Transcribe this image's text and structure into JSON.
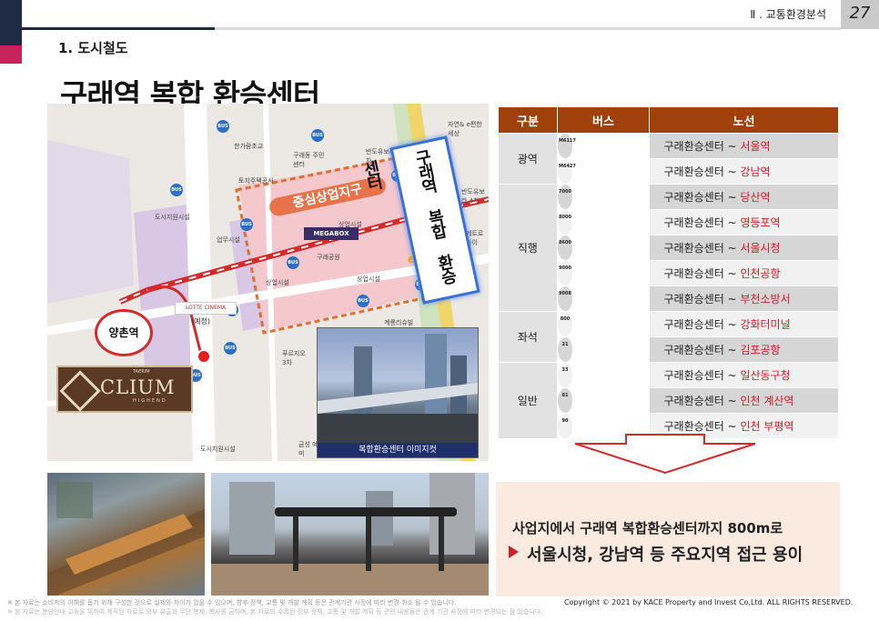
{
  "header": {
    "page_number": "27",
    "section": "Ⅱ . 교통환경분석"
  },
  "subtitle": "1. 도시철도",
  "title": "구래역 복합 환승센터",
  "map": {
    "zone_label": "중심상업지구",
    "center_banner": "구래역 복합 환승센터",
    "station": "양촌역",
    "megabox": "MEGABOX",
    "emart": "emart",
    "lotte": "LOTTE CINEMA",
    "lotte_note": "(예정)",
    "logo": {
      "brand": "CLIUM",
      "top": "TAERIM",
      "bottom": "HIGHEND"
    },
    "inset_caption": "복합환승센터 이미지컷",
    "labels": {
      "school": "한가람초교",
      "apt": "구래동 주민센터",
      "land": "토지주택공사",
      "banduyubo": "반도유보라 5차",
      "banduyubo4": "반도유보라 4차",
      "nature": "자연& e편한세상",
      "support1": "도시지원시설",
      "support2": "도시지원시설",
      "biz": "업무시설",
      "commerce1": "상업시설",
      "commerce2": "상업시설",
      "commerce3": "상업시설",
      "park": "구래공원",
      "prugio": "푸르지오 3차",
      "gyeryong": "계룡리슈빌",
      "geumsung": "금성 예미",
      "metapolis": "메트로 자이"
    },
    "bus_icon": "BUS"
  },
  "table": {
    "headers": [
      "구분",
      "버스",
      "노선"
    ],
    "route_prefix": "구래환승센터 ~ ",
    "groups": [
      {
        "category": "광역",
        "rows": [
          {
            "bus": "M6117",
            "dest": "서울역"
          },
          {
            "bus": "M6427",
            "dest": "강남역"
          }
        ]
      },
      {
        "category": "직행",
        "rows": [
          {
            "bus": "7000",
            "dest": "당산역"
          },
          {
            "bus": "8000",
            "dest": "영등포역"
          },
          {
            "bus": "8600",
            "dest": "서울시청"
          },
          {
            "bus": "9000",
            "dest": "인천공항"
          },
          {
            "bus": "9008",
            "dest": "부천소방서"
          }
        ]
      },
      {
        "category": "좌석",
        "rows": [
          {
            "bus": "800",
            "dest": "강화터미널"
          },
          {
            "bus": "21",
            "dest": "김포공항"
          }
        ]
      },
      {
        "category": "일반",
        "rows": [
          {
            "bus": "33",
            "dest": "일산동구청"
          },
          {
            "bus": "81",
            "dest": "인천 계산역"
          },
          {
            "bus": "90",
            "dest": "인천 부평역"
          }
        ]
      }
    ]
  },
  "summary": {
    "line1": "사업지에서 구래역 복합환승센터까지 800m로",
    "line2": "서울시청, 강남역 등 주요지역 접근 용이"
  },
  "footer": {
    "note1": "※ 본 자료는 소비자의 이해를 돕기 위해 구성한 것으로 실제와 차이가 있을 수 있으며, 향후 정책, 교통 및 개발 계획 등은 관계기관 사정에 따라 변경·취소 될 수 있습니다.",
    "note2": "※ 본 자료는 분양안내 교육을 위하여 제작된 자료로 외부 유출과 무단 복제, 복사를 금하며, 본 자료의 수록된 정부 정책, 교통 및 개발 계획 등 관련 내용들은 관계 기관 사정에 따라 변경되는 점 있습니다.",
    "copyright": "Copyright © 2021 by KACE Property and Invest Co,Ltd. ALL RIGHTS RESERVED."
  },
  "colors": {
    "navy": "#1f2a44",
    "accent_pink": "#c6245a",
    "table_header": "#a0410c",
    "dest_red": "#c8202a",
    "summary_bg": "#fbeadf"
  }
}
